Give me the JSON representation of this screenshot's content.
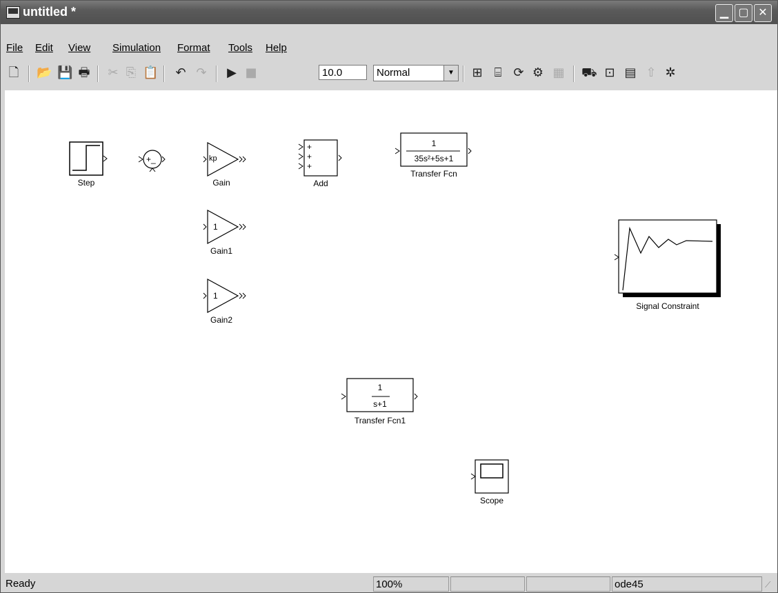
{
  "window": {
    "title": "untitled *"
  },
  "title_buttons": [
    "minimize",
    "maximize",
    "close"
  ],
  "menu": [
    {
      "label": "File",
      "mnemonic": "F"
    },
    {
      "label": "Edit",
      "mnemonic": "E"
    },
    {
      "label": "View",
      "mnemonic": "V"
    },
    {
      "label": "Simulation",
      "mnemonic": "S"
    },
    {
      "label": "Format",
      "mnemonic": "o"
    },
    {
      "label": "Tools",
      "mnemonic": "T"
    },
    {
      "label": "Help",
      "mnemonic": "H"
    }
  ],
  "toolbar": {
    "stop_time": "10.0",
    "sim_mode": "Normal"
  },
  "blocks": {
    "step": {
      "label": "Step"
    },
    "gain": {
      "label": "Gain",
      "value": "kp"
    },
    "add": {
      "label": "Add",
      "signs": [
        "+",
        "+",
        "+"
      ]
    },
    "sum": {
      "signs": "+_"
    },
    "tf1": {
      "label": "Transfer Fcn",
      "num": "1",
      "den": "35s²+5s+1"
    },
    "gain1": {
      "label": "Gain1",
      "value": "1"
    },
    "gain2": {
      "label": "Gain2",
      "value": "1"
    },
    "signal": {
      "label": "Signal Constraint"
    },
    "tf2": {
      "label": "Transfer Fcn1",
      "num": "1",
      "den": "s+1"
    },
    "scope": {
      "label": "Scope"
    }
  },
  "status": {
    "text": "Ready",
    "zoom": "100%",
    "solver": "ode45"
  }
}
